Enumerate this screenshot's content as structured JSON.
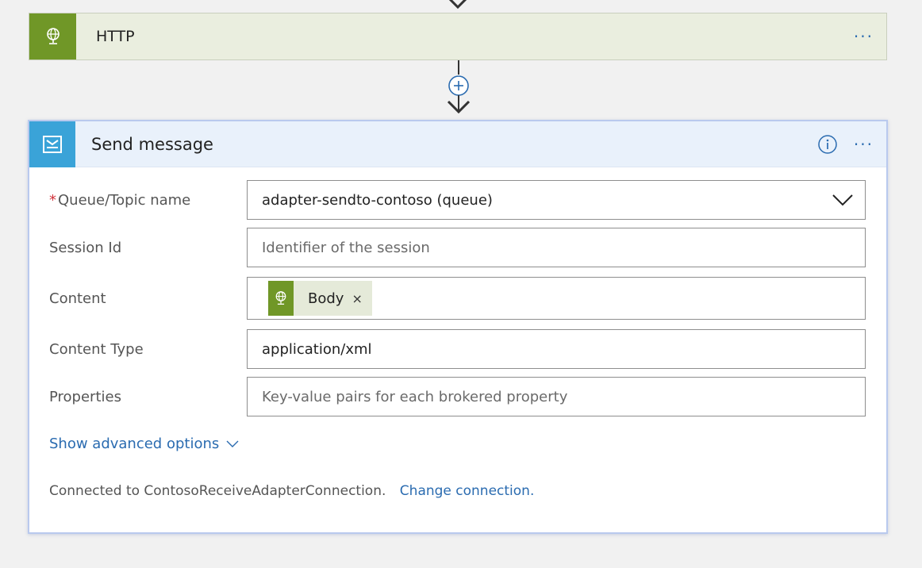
{
  "http_step": {
    "title": "HTTP",
    "icon": "globe-icon",
    "menu_label": "···"
  },
  "connector": {
    "icon": "add-step-icon"
  },
  "send_step": {
    "title": "Send message",
    "icon": "service-bus-icon",
    "info_icon": "info-icon",
    "menu_label": "···",
    "fields": {
      "queue": {
        "required_marker": "*",
        "label": "Queue/Topic name",
        "value": "adapter-sendto-contoso (queue)"
      },
      "session": {
        "label": "Session Id",
        "placeholder": "Identifier of the session"
      },
      "content": {
        "label": "Content",
        "token_label": "Body",
        "token_close": "×"
      },
      "content_type": {
        "label": "Content Type",
        "value": "application/xml"
      },
      "properties": {
        "label": "Properties",
        "placeholder": "Key-value pairs for each brokered property"
      }
    },
    "advanced_label": "Show advanced options",
    "connection_text": "Connected to ContosoReceiveAdapterConnection.",
    "change_connection_label": "Change connection."
  },
  "colors": {
    "http_accent": "#709727",
    "service_bus_accent": "#3aa3d8",
    "link": "#2a6bb0",
    "required": "#d1333b"
  }
}
